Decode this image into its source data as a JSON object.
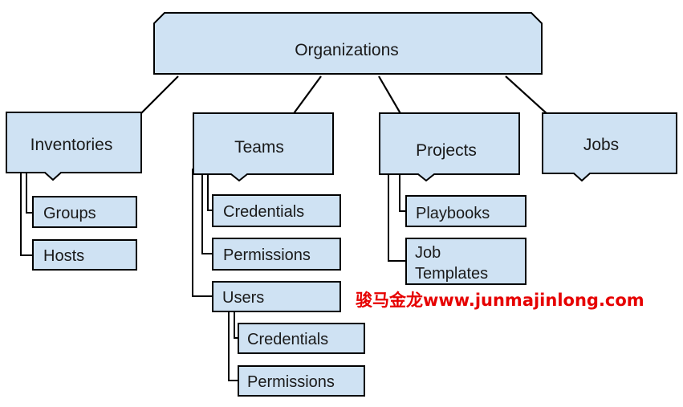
{
  "root": {
    "label": "Organizations"
  },
  "categories": {
    "inventories": {
      "label": "Inventories",
      "children": [
        "Groups",
        "Hosts"
      ]
    },
    "teams": {
      "label": "Teams",
      "children": [
        "Credentials",
        "Permissions"
      ],
      "users": {
        "label": "Users",
        "children": [
          "Credentials",
          "Permissions"
        ]
      }
    },
    "projects": {
      "label": "Projects",
      "children": [
        "Playbooks"
      ],
      "job_templates": [
        "Job",
        "Templates"
      ]
    },
    "jobs": {
      "label": "Jobs"
    }
  },
  "watermark": "骏马金龙www.junmajinlong.com",
  "colors": {
    "box_fill": "#cfe2f3",
    "stroke": "#000000",
    "watermark": "#e60000"
  }
}
